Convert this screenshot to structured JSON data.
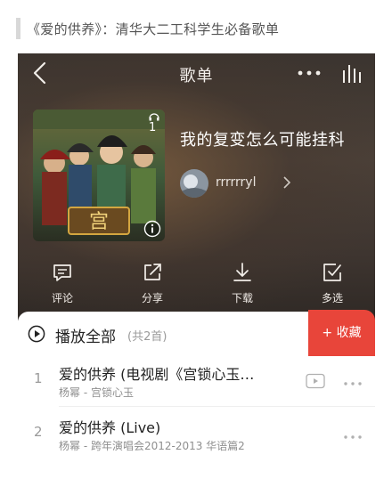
{
  "caption": {
    "text": "《爱的供养》：清华大二工科学生必备歌单"
  },
  "nav": {
    "title": "歌单",
    "back_icon": "chevron-left-icon",
    "more_icon": "more-dots-icon",
    "right_icon": "equalizer-bars-icon"
  },
  "playlist": {
    "name": "我的复变怎么可能挂科",
    "play_count": "1",
    "creator": {
      "name": "rrrrrryl"
    }
  },
  "actions": [
    {
      "label": "评论",
      "icon": "comment-icon"
    },
    {
      "label": "分享",
      "icon": "share-icon"
    },
    {
      "label": "下载",
      "icon": "download-icon"
    },
    {
      "label": "多选",
      "icon": "multiselect-icon"
    }
  ],
  "list": {
    "play_all": "播放全部",
    "count": "(共2首)",
    "collect": "+ 收藏",
    "songs": [
      {
        "index": "1",
        "title": "爱的供养 (电视剧《宫锁心玉…",
        "subtitle": "杨幂 - 宫锁心玉",
        "has_mv": true
      },
      {
        "index": "2",
        "title": "爱的供养 (Live)",
        "subtitle": "杨幂 - 跨年演唱会2012-2013 华语篇2",
        "has_mv": false
      }
    ]
  },
  "colors": {
    "accent": "#e8453a",
    "header_bg": "#3f3630"
  }
}
